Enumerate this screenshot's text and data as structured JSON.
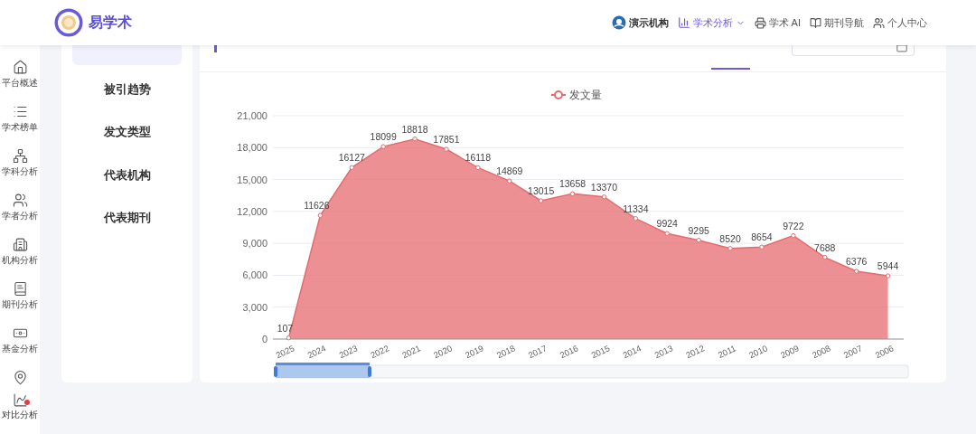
{
  "header": {
    "brand": "易学术",
    "nav": [
      {
        "label": "演示机构",
        "kind": "org",
        "selected": false,
        "dropdown": false
      },
      {
        "label": "学术分析",
        "kind": "analysis",
        "selected": true,
        "dropdown": true
      },
      {
        "label": "学术 AI",
        "kind": "ai",
        "selected": false,
        "dropdown": false
      },
      {
        "label": "期刊导航",
        "kind": "journal",
        "selected": false,
        "dropdown": false
      },
      {
        "label": "个人中心",
        "kind": "user",
        "selected": false,
        "dropdown": false
      }
    ]
  },
  "sidebar": {
    "items": [
      {
        "label": "平台概述",
        "kind": "home"
      },
      {
        "label": "学术榜单",
        "kind": "list"
      },
      {
        "label": "学科分析",
        "kind": "tree"
      },
      {
        "label": "学者分析",
        "kind": "people"
      },
      {
        "label": "机构分析",
        "kind": "building"
      },
      {
        "label": "期刊分析",
        "kind": "journal"
      },
      {
        "label": "基金分析",
        "kind": "fund"
      },
      {
        "kind": "location"
      }
    ],
    "floating": {
      "label": "对比分析"
    }
  },
  "submenu": [
    {
      "selected": true
    },
    {
      "label": "被引趋势",
      "selected": false
    },
    {
      "label": "发文类型",
      "selected": false
    },
    {
      "label": "代表机构",
      "selected": false
    },
    {
      "label": "代表期刊",
      "selected": false
    }
  ],
  "chart": {
    "chart_data": {
      "type": "area",
      "categories": [
        "2025",
        "2024",
        "2023",
        "2022",
        "2021",
        "2020",
        "2019",
        "2018",
        "2017",
        "2016",
        "2015",
        "2014",
        "2013",
        "2012",
        "2011",
        "2010",
        "2009",
        "2008",
        "2007",
        "2006"
      ],
      "series": [
        {
          "name": "发文量",
          "color": "#e56b6f",
          "values": [
            107,
            11626,
            16127,
            18099,
            18818,
            17851,
            16118,
            14869,
            13015,
            13658,
            13370,
            11334,
            9924,
            9295,
            8520,
            8654,
            9722,
            7688,
            6376,
            5944
          ]
        }
      ],
      "ylim": [
        0,
        21000
      ],
      "yticks": [
        {
          "value": 0,
          "label": "0"
        },
        {
          "value": 3000,
          "label": "3,000"
        },
        {
          "value": 6000,
          "label": "6,000"
        },
        {
          "value": 9000,
          "label": "9,000"
        },
        {
          "value": 12000,
          "label": "12,000"
        },
        {
          "value": 15000,
          "label": "15,000"
        },
        {
          "value": 18000,
          "label": "18,000"
        },
        {
          "value": 21000,
          "label": "21,000"
        }
      ],
      "data_labels": true,
      "grid": true
    }
  }
}
